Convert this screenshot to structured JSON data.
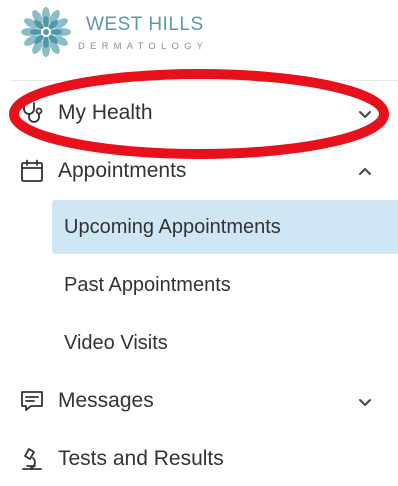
{
  "brand": {
    "name": "WEST HILLS",
    "subtitle": "DERMATOLOGY",
    "primary_color": "#5a9aad",
    "logo_icon": "mandala-flower-icon"
  },
  "nav": {
    "items": [
      {
        "label": "My Health",
        "icon": "stethoscope-icon",
        "chevron": "chevron-down-icon",
        "expanded": false
      },
      {
        "label": "Appointments",
        "icon": "calendar-icon",
        "chevron": "chevron-up-icon",
        "expanded": true,
        "children": [
          {
            "label": "Upcoming Appointments",
            "active": true
          },
          {
            "label": "Past Appointments",
            "active": false
          },
          {
            "label": "Video Visits",
            "active": false
          }
        ]
      },
      {
        "label": "Messages",
        "icon": "message-icon",
        "chevron": "chevron-down-icon",
        "expanded": false
      },
      {
        "label": "Tests and Results",
        "icon": "microscope-icon"
      }
    ]
  },
  "annotation": {
    "color": "#e8101a",
    "shape": "ellipse",
    "target": "My Health"
  },
  "colors": {
    "active_background": "#cfe6f5",
    "text": "#333333"
  }
}
